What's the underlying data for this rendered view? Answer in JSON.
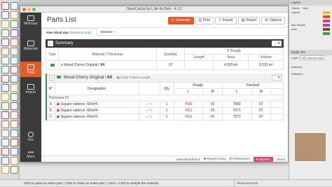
{
  "window_title": "OpenCutList by L'Air du Bois - 4.1.2",
  "sidebar": {
    "items": [
      {
        "label": "Minimize"
      },
      {
        "label": "Materials"
      },
      {
        "label": "Parts"
      },
      {
        "label": "Import"
      },
      {
        "label": "Doc"
      },
      {
        "label": "More"
      }
    ]
  },
  "header": {
    "title": "Parts List",
    "buttons": [
      "Generate",
      "Print",
      "Export",
      "Report",
      "Options"
    ]
  },
  "tabs": {
    "model_tab": "Alex Ghali.skp",
    "model_tab_suffix": "(Selection only)",
    "second_tab": "Mètreter"
  },
  "summary": {
    "title": "Summary",
    "col_type": "Type",
    "col_material": "Material / Thickness",
    "col_quantity": "Quantity",
    "col_rough": "Σ Rough",
    "col_length": "Length",
    "col_area": "Area",
    "col_volume": "Volume",
    "row": {
      "material": "Wood Cherry Original",
      "thickness": "64",
      "quantity": "17",
      "length": "",
      "area": "4.929 m²",
      "volume": "0.315 m³"
    }
  },
  "group": {
    "title": "Wood Cherry Original",
    "thickness": "64",
    "grain": "Grain Follows Length",
    "col_no": "N°",
    "col_designation": "Designation",
    "col_qty": "Qty",
    "col_rough": "Rough",
    "col_finished": "Finished",
    "col_l": "L",
    "col_w": "W",
    "thickness_label": "Thickness 57",
    "parts": [
      {
        "no": "A",
        "name": "Square valence -65m#5",
        "qty": "1",
        "rl": "7630",
        "rw": "65",
        "fl": "7580",
        "fw": "57"
      },
      {
        "no": "B",
        "name": "Square valence -65m#4",
        "qty": "1",
        "rl": "7621",
        "rw": "65",
        "fl": "7571",
        "fw": "57"
      },
      {
        "no": "C",
        "name": "Square valence -65m#3",
        "qty": "1",
        "rl": "7621",
        "rw": "65",
        "fl": "7571",
        "fw": "57"
      }
    ]
  },
  "footer": {
    "site": "www.lairdubois.fr",
    "bug": "Report a bug",
    "prefs": "Preferences",
    "sponsor": "Sponsor",
    "about": "About"
  },
  "right_panel": {
    "title": "Layers",
    "visible_label": "Visible",
    "color_label": "Color",
    "layers": [
      {
        "name": "Layer0",
        "color": "#f0c020"
      },
      {
        "name": "",
        "color": "#e05030"
      },
      {
        "name": "",
        "color": "#d04070"
      },
      {
        "name": "ster frames",
        "color": "#9050c0"
      },
      {
        "name": "ame",
        "color": "#7a4a20"
      },
      {
        "name": "",
        "color": "#40a040"
      }
    ],
    "entity_info": "Entity Info",
    "layer_label": "Layer:",
    "layer_value": "LED valence stat",
    "instance_label": "Instance:",
    "definition_label": "Definition:"
  },
  "status_bar": {
    "hint": "Click to paint an entire part. | Click to clean an entire part. | Cmd = Click to sample the material.",
    "measurements": "Measurements"
  },
  "colors": {
    "accent": "#e65a26",
    "sidebar": "#3b3b3b",
    "group_border": "#2ea043",
    "sponsor": "#e0407f",
    "rough_values": "#c2272d"
  }
}
